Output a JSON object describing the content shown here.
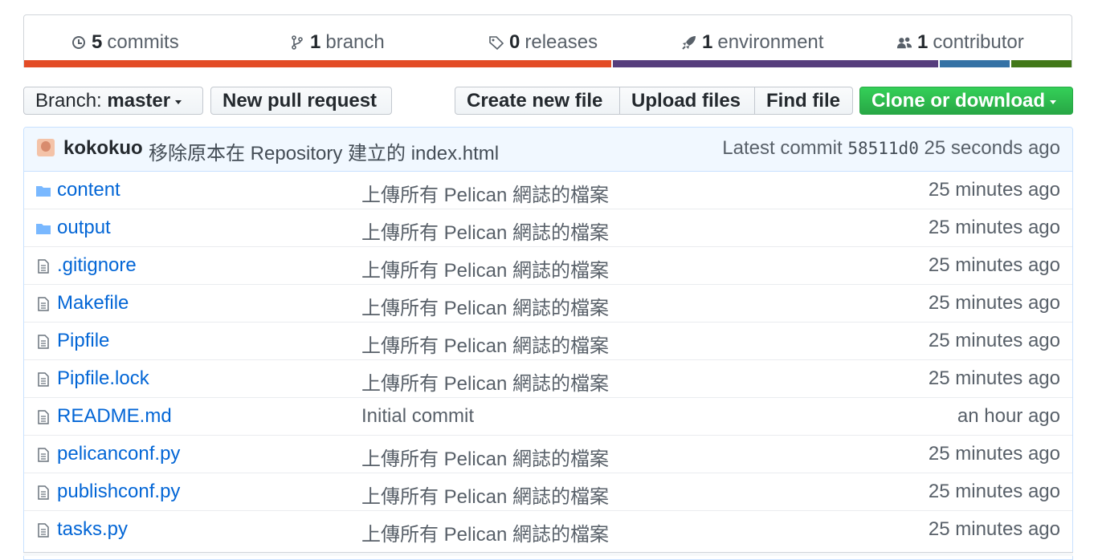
{
  "summary": {
    "commits": {
      "count": "5",
      "label": "commits",
      "icon": "history-icon"
    },
    "branches": {
      "count": "1",
      "label": "branch",
      "icon": "branch-icon"
    },
    "releases": {
      "count": "0",
      "label": "releases",
      "icon": "tag-icon"
    },
    "environments": {
      "count": "1",
      "label": "environment",
      "icon": "rocket-icon"
    },
    "contributors": {
      "count": "1",
      "label": "contributor",
      "icon": "people-icon"
    },
    "language_colors": [
      "#e34c26",
      "#563d7c",
      "#3572a5",
      "#427819"
    ]
  },
  "toolbar": {
    "branch_prefix": "Branch:",
    "branch_name": "master",
    "new_pull_request": "New pull request",
    "create_new_file": "Create new file",
    "upload_files": "Upload files",
    "find_file": "Find file",
    "clone_or_download": "Clone or download"
  },
  "commit": {
    "author": "kokokuo",
    "message": "移除原本在 Repository 建立的 index.html",
    "latest_label": "Latest commit",
    "sha": "58511d0",
    "age": "25 seconds ago"
  },
  "files": [
    {
      "name": "content",
      "type": "folder",
      "message": "上傳所有 Pelican 網誌的檔案",
      "age": "25 minutes ago"
    },
    {
      "name": "output",
      "type": "folder",
      "message": "上傳所有 Pelican 網誌的檔案",
      "age": "25 minutes ago"
    },
    {
      "name": ".gitignore",
      "type": "file",
      "message": "上傳所有 Pelican 網誌的檔案",
      "age": "25 minutes ago"
    },
    {
      "name": "Makefile",
      "type": "file",
      "message": "上傳所有 Pelican 網誌的檔案",
      "age": "25 minutes ago"
    },
    {
      "name": "Pipfile",
      "type": "file",
      "message": "上傳所有 Pelican 網誌的檔案",
      "age": "25 minutes ago"
    },
    {
      "name": "Pipfile.lock",
      "type": "file",
      "message": "上傳所有 Pelican 網誌的檔案",
      "age": "25 minutes ago"
    },
    {
      "name": "README.md",
      "type": "file",
      "message": "Initial commit",
      "age": "an hour ago"
    },
    {
      "name": "pelicanconf.py",
      "type": "file",
      "message": "上傳所有 Pelican 網誌的檔案",
      "age": "25 minutes ago"
    },
    {
      "name": "publishconf.py",
      "type": "file",
      "message": "上傳所有 Pelican 網誌的檔案",
      "age": "25 minutes ago"
    },
    {
      "name": "tasks.py",
      "type": "file",
      "message": "上傳所有 Pelican 網誌的檔案",
      "age": "25 minutes ago"
    }
  ]
}
